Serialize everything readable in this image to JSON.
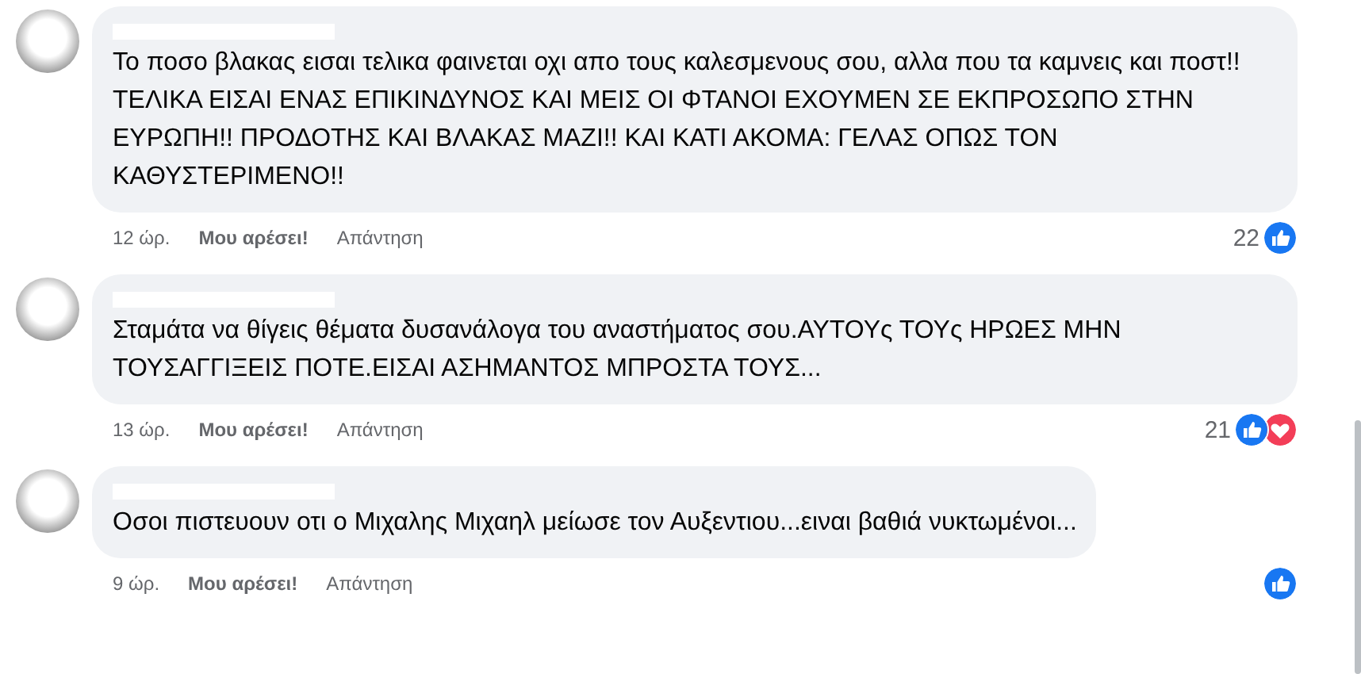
{
  "comments": [
    {
      "text": "Το ποσο βλακας εισαι τελικα φαινεται οχι απο τους καλεσμενους σου, αλλα που τα καμνεις και ποστ!! ΤΕΛΙΚΑ ΕΙΣΑΙ ΕΝΑΣ ΕΠΙΚΙΝΔΥΝΟΣ ΚΑΙ ΜΕΙΣ ΟΙ ΦΤΑΝΟΙ ΕΧΟΥΜΕΝ ΣΕ ΕΚΠΡΟΣΩΠΟ ΣΤΗΝ ΕΥΡΩΠΗ!! ΠΡΟΔΟΤΗΣ ΚΑΙ ΒΛΑΚΑΣ ΜΑΖΙ!! ΚΑΙ ΚΑΤΙ ΑΚΟΜΑ: ΓΕΛΑΣ ΟΠΩΣ ΤΟΝ ΚΑΘΥΣΤΕΡΙΜΕΝΟ!!",
      "time": "12 ώρ.",
      "like_label": "Μου αρέσει!",
      "reply_label": "Απάντηση",
      "reaction_count": "22",
      "reactions": [
        {
          "kind": "like"
        }
      ]
    },
    {
      "text": "Σταμάτα να θίγεις θέματα δυσανάλογα του αναστήματος σου.ΑΥΤΟΥς ΤΟΥς ΗΡΩΕΣ ΜΗΝ ΤΟΥΣΑΓΓΙΞΕΙΣ ΠΟΤΕ.ΕΙΣΑΙ ΑΣΗΜΑΝΤΟΣ ΜΠΡΟΣΤΑ ΤΟΥΣ...",
      "time": "13 ώρ.",
      "like_label": "Μου αρέσει!",
      "reply_label": "Απάντηση",
      "reaction_count": "21",
      "reactions": [
        {
          "kind": "like"
        },
        {
          "kind": "love"
        }
      ]
    },
    {
      "text": "Οσοι πιστευουν οτι ο Μιχαλης Μιχαηλ μείωσε τον Αυξεντιου...ειναι βαθιά νυκτωμένοι...",
      "time": "9 ώρ.",
      "like_label": "Μου αρέσει!",
      "reply_label": "Απάντηση",
      "reactions": [
        {
          "kind": "like"
        }
      ]
    }
  ]
}
